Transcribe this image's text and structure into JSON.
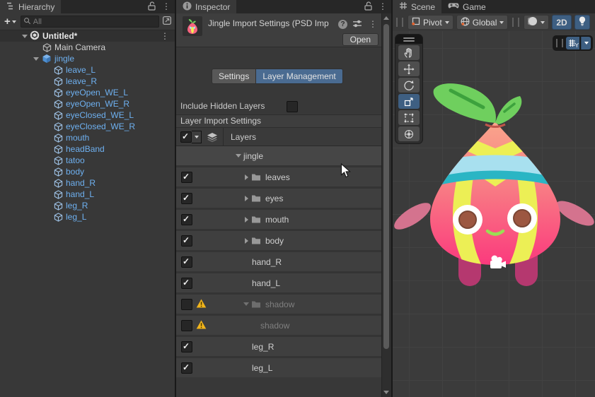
{
  "hierarchy": {
    "tab_label": "Hierarchy",
    "toolbar": {
      "add_label": "+",
      "search_placeholder": "All"
    },
    "scene_row": {
      "label": "Untitled*"
    },
    "items": [
      {
        "label": "Main Camera",
        "depth": 1,
        "icon": "cube",
        "prefab": false,
        "triangle": null
      },
      {
        "label": "jingle",
        "depth": 1,
        "icon": "prefab-cube",
        "prefab": true,
        "triangle": "down"
      },
      {
        "label": "leave_L",
        "depth": 2,
        "icon": "cube",
        "prefab": true,
        "triangle": null
      },
      {
        "label": "leave_R",
        "depth": 2,
        "icon": "cube",
        "prefab": true,
        "triangle": null
      },
      {
        "label": "eyeOpen_WE_L",
        "depth": 2,
        "icon": "cube",
        "prefab": true,
        "triangle": null
      },
      {
        "label": "eyeOpen_WE_R",
        "depth": 2,
        "icon": "cube",
        "prefab": true,
        "triangle": null
      },
      {
        "label": "eyeClosed_WE_L",
        "depth": 2,
        "icon": "cube",
        "prefab": true,
        "triangle": null
      },
      {
        "label": "eyeClosed_WE_R",
        "depth": 2,
        "icon": "cube",
        "prefab": true,
        "triangle": null
      },
      {
        "label": "mouth",
        "depth": 2,
        "icon": "cube",
        "prefab": true,
        "triangle": null
      },
      {
        "label": "headBand",
        "depth": 2,
        "icon": "cube",
        "prefab": true,
        "triangle": null
      },
      {
        "label": "tatoo",
        "depth": 2,
        "icon": "cube",
        "prefab": true,
        "triangle": null
      },
      {
        "label": "body",
        "depth": 2,
        "icon": "cube",
        "prefab": true,
        "triangle": null
      },
      {
        "label": "hand_R",
        "depth": 2,
        "icon": "cube",
        "prefab": true,
        "triangle": null
      },
      {
        "label": "hand_L",
        "depth": 2,
        "icon": "cube",
        "prefab": true,
        "triangle": null
      },
      {
        "label": "leg_R",
        "depth": 2,
        "icon": "cube",
        "prefab": true,
        "triangle": null
      },
      {
        "label": "leg_L",
        "depth": 2,
        "icon": "cube",
        "prefab": true,
        "triangle": null
      }
    ]
  },
  "inspector": {
    "tab_label": "Inspector",
    "header": {
      "title": "Jingle Import Settings (PSD Imp",
      "open_label": "Open",
      "help_glyph": "?"
    },
    "tabs": [
      {
        "label": "Settings",
        "active": false
      },
      {
        "label": "Layer Management",
        "active": true
      }
    ],
    "include_hidden_label": "Include Hidden Layers",
    "include_hidden_checked": false,
    "section_title": "Layer Import Settings",
    "table_header_label": "Layers",
    "layers": [
      {
        "label": "jingle",
        "type": "root",
        "depth": 0,
        "checked": null,
        "warning": false,
        "triangle": "down",
        "disabled": false
      },
      {
        "label": "leaves",
        "type": "folder",
        "depth": 1,
        "checked": true,
        "warning": false,
        "triangle": "right",
        "disabled": false
      },
      {
        "label": "eyes",
        "type": "folder",
        "depth": 1,
        "checked": true,
        "warning": false,
        "triangle": "right",
        "disabled": false
      },
      {
        "label": "mouth",
        "type": "folder",
        "depth": 1,
        "checked": true,
        "warning": false,
        "triangle": "right",
        "disabled": false
      },
      {
        "label": "body",
        "type": "folder",
        "depth": 1,
        "checked": true,
        "warning": false,
        "triangle": "right",
        "disabled": false
      },
      {
        "label": "hand_R",
        "type": "layer",
        "depth": 1,
        "checked": true,
        "warning": false,
        "triangle": null,
        "disabled": false
      },
      {
        "label": "hand_L",
        "type": "layer",
        "depth": 1,
        "checked": true,
        "warning": false,
        "triangle": null,
        "disabled": false
      },
      {
        "label": "shadow",
        "type": "folder",
        "depth": 1,
        "checked": false,
        "warning": true,
        "triangle": "down",
        "disabled": true
      },
      {
        "label": "shadow",
        "type": "layer",
        "depth": 2,
        "checked": false,
        "warning": true,
        "triangle": null,
        "disabled": true
      },
      {
        "label": "leg_R",
        "type": "layer",
        "depth": 1,
        "checked": true,
        "warning": false,
        "triangle": null,
        "disabled": false
      },
      {
        "label": "leg_L",
        "type": "layer",
        "depth": 1,
        "checked": true,
        "warning": false,
        "triangle": null,
        "disabled": false
      }
    ]
  },
  "scene": {
    "tabs": [
      {
        "label": "Scene",
        "active": true
      },
      {
        "label": "Game",
        "active": false
      }
    ],
    "toolbar": {
      "pivot_label": "Pivot",
      "global_label": "Global",
      "mode_2d_label": "2D"
    },
    "tools": [
      "hand",
      "move",
      "rotate",
      "scale",
      "rect",
      "transform"
    ],
    "active_tool": "scale",
    "grid_toolbar": {
      "axis_label": "Y"
    }
  },
  "colors": {
    "accent_blue": "#3e5f82",
    "tab_blue": "#4a6b91",
    "prefab_text": "#6eb0f0",
    "warning_yellow": "#f1b41b",
    "panel_bg": "#383838",
    "scene_bg": "#3b3b3b",
    "character_body_top": "#f9a58b",
    "character_body_bottom": "#fb3a7d",
    "character_leaf": "#6fcf5e",
    "character_band": "#a8e0ef",
    "character_band_edge": "#2ab5c4",
    "character_stripe": "#ecef55"
  }
}
